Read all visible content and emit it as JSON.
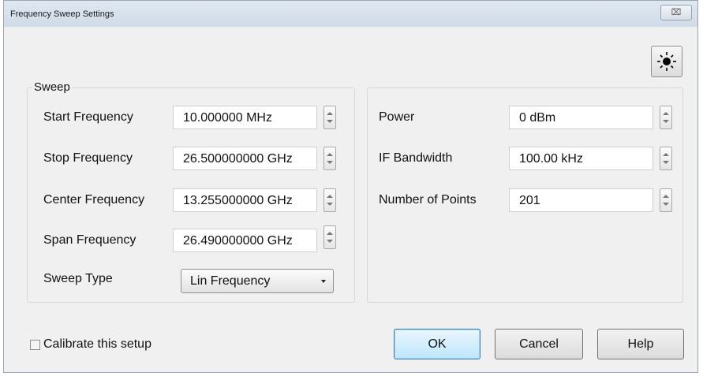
{
  "window": {
    "title": "Frequency Sweep Settings",
    "close_glyph": "⌧"
  },
  "sweep": {
    "group_label": "Sweep",
    "start": {
      "label": "Start Frequency",
      "value": "10.000000 MHz"
    },
    "stop": {
      "label": "Stop Frequency",
      "value": "26.500000000 GHz"
    },
    "center": {
      "label": "Center Frequency",
      "value": "13.255000000 GHz"
    },
    "span": {
      "label": "Span Frequency",
      "value": "26.490000000 GHz"
    },
    "type": {
      "label": "Sweep Type",
      "value": "Lin Frequency"
    }
  },
  "settings": {
    "power": {
      "label": "Power",
      "value": "0 dBm"
    },
    "if_bw": {
      "label": "IF Bandwidth",
      "value": "100.00 kHz"
    },
    "points": {
      "label": "Number of Points",
      "value": "201"
    }
  },
  "footer": {
    "calibrate_label": "Calibrate this setup",
    "calibrate_checked": false,
    "ok_label": "OK",
    "cancel_label": "Cancel",
    "help_label": "Help"
  },
  "icons": {
    "title_close": "close-icon",
    "display": "sun-icon",
    "dropdown": "chevron-down-icon"
  }
}
